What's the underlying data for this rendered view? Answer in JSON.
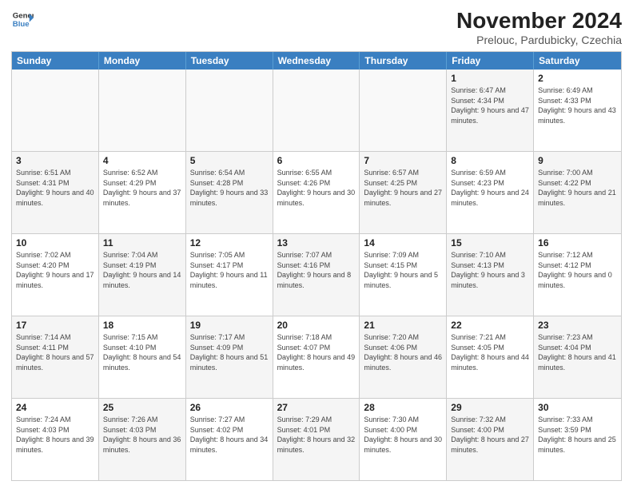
{
  "logo": {
    "line1": "General",
    "line2": "Blue"
  },
  "title": "November 2024",
  "subtitle": "Prelouc, Pardubicky, Czechia",
  "header_days": [
    "Sunday",
    "Monday",
    "Tuesday",
    "Wednesday",
    "Thursday",
    "Friday",
    "Saturday"
  ],
  "rows": [
    [
      {
        "day": "",
        "info": ""
      },
      {
        "day": "",
        "info": ""
      },
      {
        "day": "",
        "info": ""
      },
      {
        "day": "",
        "info": ""
      },
      {
        "day": "",
        "info": ""
      },
      {
        "day": "1",
        "info": "Sunrise: 6:47 AM\nSunset: 4:34 PM\nDaylight: 9 hours\nand 47 minutes."
      },
      {
        "day": "2",
        "info": "Sunrise: 6:49 AM\nSunset: 4:33 PM\nDaylight: 9 hours\nand 43 minutes."
      }
    ],
    [
      {
        "day": "3",
        "info": "Sunrise: 6:51 AM\nSunset: 4:31 PM\nDaylight: 9 hours\nand 40 minutes."
      },
      {
        "day": "4",
        "info": "Sunrise: 6:52 AM\nSunset: 4:29 PM\nDaylight: 9 hours\nand 37 minutes."
      },
      {
        "day": "5",
        "info": "Sunrise: 6:54 AM\nSunset: 4:28 PM\nDaylight: 9 hours\nand 33 minutes."
      },
      {
        "day": "6",
        "info": "Sunrise: 6:55 AM\nSunset: 4:26 PM\nDaylight: 9 hours\nand 30 minutes."
      },
      {
        "day": "7",
        "info": "Sunrise: 6:57 AM\nSunset: 4:25 PM\nDaylight: 9 hours\nand 27 minutes."
      },
      {
        "day": "8",
        "info": "Sunrise: 6:59 AM\nSunset: 4:23 PM\nDaylight: 9 hours\nand 24 minutes."
      },
      {
        "day": "9",
        "info": "Sunrise: 7:00 AM\nSunset: 4:22 PM\nDaylight: 9 hours\nand 21 minutes."
      }
    ],
    [
      {
        "day": "10",
        "info": "Sunrise: 7:02 AM\nSunset: 4:20 PM\nDaylight: 9 hours\nand 17 minutes."
      },
      {
        "day": "11",
        "info": "Sunrise: 7:04 AM\nSunset: 4:19 PM\nDaylight: 9 hours\nand 14 minutes."
      },
      {
        "day": "12",
        "info": "Sunrise: 7:05 AM\nSunset: 4:17 PM\nDaylight: 9 hours\nand 11 minutes."
      },
      {
        "day": "13",
        "info": "Sunrise: 7:07 AM\nSunset: 4:16 PM\nDaylight: 9 hours\nand 8 minutes."
      },
      {
        "day": "14",
        "info": "Sunrise: 7:09 AM\nSunset: 4:15 PM\nDaylight: 9 hours\nand 5 minutes."
      },
      {
        "day": "15",
        "info": "Sunrise: 7:10 AM\nSunset: 4:13 PM\nDaylight: 9 hours\nand 3 minutes."
      },
      {
        "day": "16",
        "info": "Sunrise: 7:12 AM\nSunset: 4:12 PM\nDaylight: 9 hours\nand 0 minutes."
      }
    ],
    [
      {
        "day": "17",
        "info": "Sunrise: 7:14 AM\nSunset: 4:11 PM\nDaylight: 8 hours\nand 57 minutes."
      },
      {
        "day": "18",
        "info": "Sunrise: 7:15 AM\nSunset: 4:10 PM\nDaylight: 8 hours\nand 54 minutes."
      },
      {
        "day": "19",
        "info": "Sunrise: 7:17 AM\nSunset: 4:09 PM\nDaylight: 8 hours\nand 51 minutes."
      },
      {
        "day": "20",
        "info": "Sunrise: 7:18 AM\nSunset: 4:07 PM\nDaylight: 8 hours\nand 49 minutes."
      },
      {
        "day": "21",
        "info": "Sunrise: 7:20 AM\nSunset: 4:06 PM\nDaylight: 8 hours\nand 46 minutes."
      },
      {
        "day": "22",
        "info": "Sunrise: 7:21 AM\nSunset: 4:05 PM\nDaylight: 8 hours\nand 44 minutes."
      },
      {
        "day": "23",
        "info": "Sunrise: 7:23 AM\nSunset: 4:04 PM\nDaylight: 8 hours\nand 41 minutes."
      }
    ],
    [
      {
        "day": "24",
        "info": "Sunrise: 7:24 AM\nSunset: 4:03 PM\nDaylight: 8 hours\nand 39 minutes."
      },
      {
        "day": "25",
        "info": "Sunrise: 7:26 AM\nSunset: 4:03 PM\nDaylight: 8 hours\nand 36 minutes."
      },
      {
        "day": "26",
        "info": "Sunrise: 7:27 AM\nSunset: 4:02 PM\nDaylight: 8 hours\nand 34 minutes."
      },
      {
        "day": "27",
        "info": "Sunrise: 7:29 AM\nSunset: 4:01 PM\nDaylight: 8 hours\nand 32 minutes."
      },
      {
        "day": "28",
        "info": "Sunrise: 7:30 AM\nSunset: 4:00 PM\nDaylight: 8 hours\nand 30 minutes."
      },
      {
        "day": "29",
        "info": "Sunrise: 7:32 AM\nSunset: 4:00 PM\nDaylight: 8 hours\nand 27 minutes."
      },
      {
        "day": "30",
        "info": "Sunrise: 7:33 AM\nSunset: 3:59 PM\nDaylight: 8 hours\nand 25 minutes."
      }
    ]
  ]
}
